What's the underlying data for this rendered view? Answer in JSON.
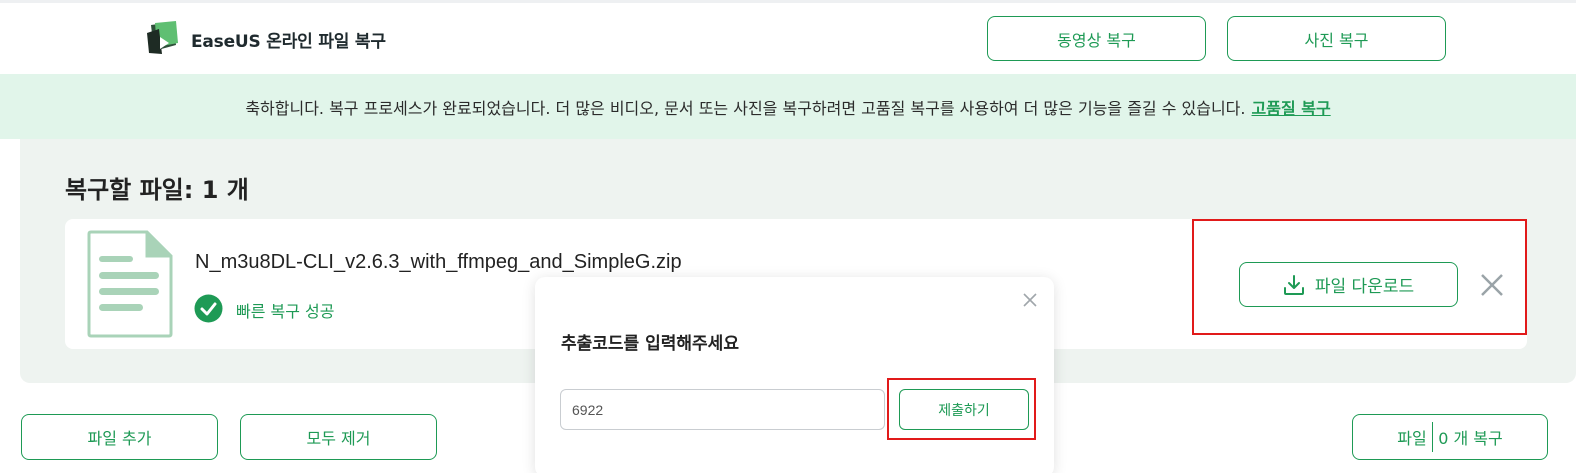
{
  "header": {
    "brand": "EaseUS 온라인 파일 복구",
    "nav": {
      "video_label": "동영상 복구",
      "photo_label": "사진 복구"
    }
  },
  "banner": {
    "message": "축하합니다. 복구 프로세스가 완료되었습니다. 더 많은 비디오, 문서 또는 사진을 복구하려면 고품질 복구를 사용하여 더 많은 기능을 즐길 수 있습니다.",
    "link_label": "고품질 복구"
  },
  "files": {
    "title": "복구할 파일: 1 개",
    "item": {
      "name": "N_m3u8DL-CLI_v2.6.3_with_ffmpeg_and_SimpleG.zip",
      "status": "빠른 복구 성공",
      "download_label": "파일 다운로드",
      "remove_icon": "close-icon"
    }
  },
  "footer": {
    "add_label": "파일 추가",
    "remove_all_label": "모두 제거",
    "recover_prefix": "파일",
    "recover_suffix": "0 개 복구"
  },
  "modal": {
    "title": "추출코드를 입력해주세요",
    "input_value": "6922",
    "submit_label": "제출하기"
  },
  "colors": {
    "accent": "#1e9a55",
    "banner_bg": "#e1f5ea",
    "highlight": "#e11a1a"
  }
}
